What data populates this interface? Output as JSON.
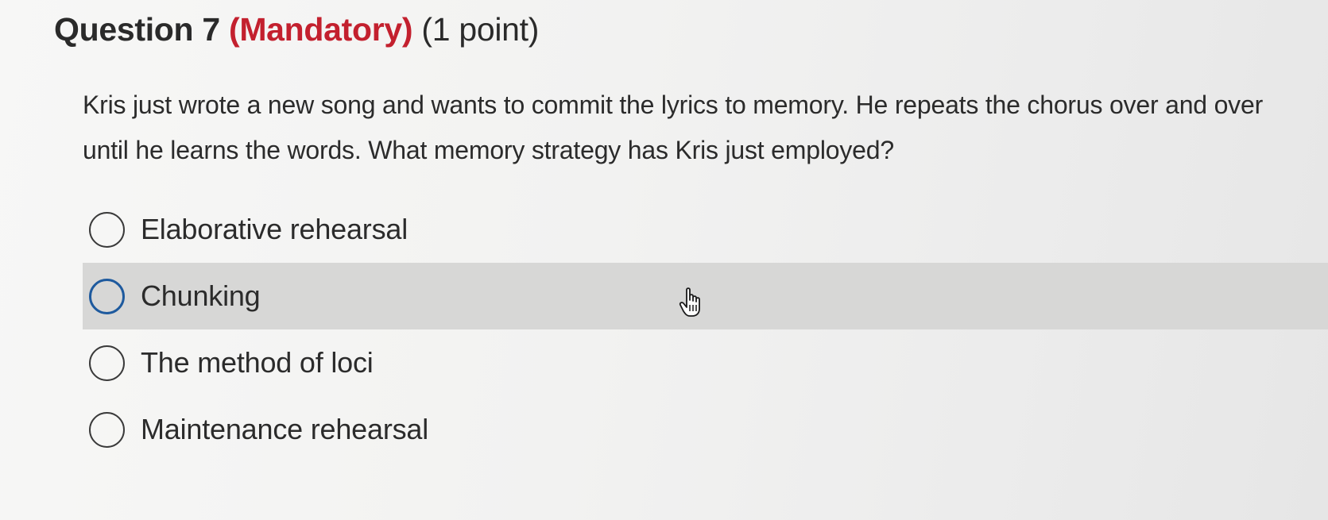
{
  "question": {
    "number_label": "Question 7",
    "mandatory_label": "(Mandatory)",
    "points_label": "(1 point)",
    "prompt": "Kris just wrote a new song and wants to commit the lyrics to memory. He repeats the chorus over and over until he learns the words. What memory strategy has Kris just employed?"
  },
  "options": [
    {
      "label": "Elaborative rehearsal"
    },
    {
      "label": "Chunking"
    },
    {
      "label": "The method of loci"
    },
    {
      "label": "Maintenance rehearsal"
    }
  ],
  "hovered_option": "Chunking",
  "colors": {
    "mandatory": "#c3202e",
    "hover_background": "#d7d7d6",
    "focus_radio": "#1e5a9e",
    "text": "#2b2b2b"
  },
  "cursor": "hand-pointer-icon"
}
